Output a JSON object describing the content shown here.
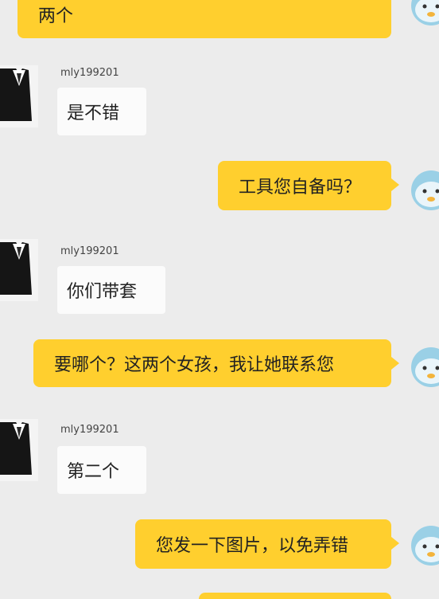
{
  "messages": [
    {
      "direction": "outgoing",
      "text": "两个"
    },
    {
      "direction": "incoming",
      "sender": "mly199201",
      "text": "是不错"
    },
    {
      "direction": "outgoing",
      "text": "工具您自备吗？"
    },
    {
      "direction": "incoming",
      "sender": "mly199201",
      "text": "你们带套"
    },
    {
      "direction": "outgoing",
      "text": "要哪个？这两个女孩，我让她联系您"
    },
    {
      "direction": "incoming",
      "sender": "mly199201",
      "text": "第二个"
    },
    {
      "direction": "outgoing",
      "text": "您发一下图片，以免弄错"
    }
  ],
  "colors": {
    "background": "#ececec",
    "outgoing_bubble": "#ffcf2e",
    "incoming_bubble": "#fbfbfb"
  },
  "icons": {
    "incoming_avatar": "black-suit-avatar",
    "outgoing_avatar": "cartoon-mascot-avatar"
  }
}
